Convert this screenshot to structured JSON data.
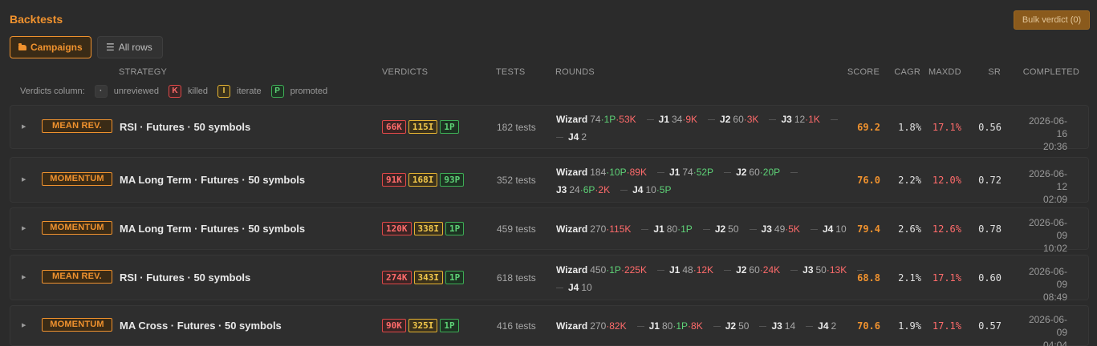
{
  "page": {
    "title": "Backtests",
    "bulk_verdict_label": "Bulk verdict (0)"
  },
  "tabs": [
    {
      "label": "Campaigns",
      "icon": "folder-icon",
      "active": true
    },
    {
      "label": "All rows",
      "icon": "list-icon",
      "active": false
    }
  ],
  "columns": {
    "strategy": "STRATEGY",
    "verdicts": "VERDICTS",
    "tests": "TESTS",
    "rounds": "ROUNDS",
    "score": "SCORE",
    "cagr": "CAGR",
    "maxdd": "MAXDD",
    "sr": "SR",
    "completed": "COMPLETED"
  },
  "legend": {
    "label": "Verdicts column:",
    "items": [
      {
        "glyph": "·",
        "text": "unreviewed",
        "kind": "dot"
      },
      {
        "glyph": "K",
        "text": "killed",
        "kind": "k"
      },
      {
        "glyph": "I",
        "text": "iterate",
        "kind": "i"
      },
      {
        "glyph": "P",
        "text": "promoted",
        "kind": "p"
      }
    ]
  },
  "colors": {
    "accent": "#f0922e",
    "killed": "#ff6b6b",
    "iterate": "#f2c84b",
    "promoted": "#5ed277",
    "background": "#2b2b2b"
  },
  "campaigns": [
    {
      "tag": "MEAN REV.",
      "strategy": "RSI · Futures · 50 symbols",
      "verdicts": {
        "k": "66K",
        "i": "115I",
        "p": "1P"
      },
      "tests": "182 tests",
      "rounds": [
        [
          {
            "name": "Wizard",
            "count": "74",
            "p": "·1P",
            "k": "·53K"
          },
          {
            "name": "J1",
            "count": "34",
            "k": "·9K"
          },
          {
            "name": "J2",
            "count": "60",
            "k": "·3K"
          },
          {
            "name": "J3",
            "count": "12",
            "k": "·1K"
          }
        ],
        [
          {
            "name": "J4",
            "count": "2"
          }
        ]
      ],
      "score": "69.2",
      "cagr": "1.8%",
      "maxdd": "17.1%",
      "sr": "0.56",
      "date": "2026-06-16",
      "time": "20:36"
    },
    {
      "tag": "MOMENTUM",
      "strategy": "MA Long Term · Futures · 50 symbols",
      "verdicts": {
        "k": "91K",
        "i": "168I",
        "p": "93P"
      },
      "tests": "352 tests",
      "rounds": [
        [
          {
            "name": "Wizard",
            "count": "184",
            "p": "·10P",
            "k": "·89K"
          },
          {
            "name": "J1",
            "count": "74",
            "p": "·52P"
          },
          {
            "name": "J2",
            "count": "60",
            "p": "·20P"
          }
        ],
        [
          {
            "name": "J3",
            "count": "24",
            "p": "·6P",
            "k": "·2K"
          },
          {
            "name": "J4",
            "count": "10",
            "p": "·5P"
          }
        ]
      ],
      "score": "76.0",
      "cagr": "2.2%",
      "maxdd": "12.0%",
      "sr": "0.72",
      "date": "2026-06-12",
      "time": "02:09"
    },
    {
      "tag": "MOMENTUM",
      "strategy": "MA Long Term · Futures · 50 symbols",
      "verdicts": {
        "k": "120K",
        "i": "338I",
        "p": "1P"
      },
      "tests": "459 tests",
      "rounds": [
        [
          {
            "name": "Wizard",
            "count": "270",
            "k": "·115K"
          },
          {
            "name": "J1",
            "count": "80",
            "p": "·1P"
          },
          {
            "name": "J2",
            "count": "50"
          },
          {
            "name": "J3",
            "count": "49",
            "k": "·5K"
          },
          {
            "name": "J4",
            "count": "10"
          }
        ]
      ],
      "score": "79.4",
      "cagr": "2.6%",
      "maxdd": "12.6%",
      "sr": "0.78",
      "date": "2026-06-09",
      "time": "10:02"
    },
    {
      "tag": "MEAN REV.",
      "strategy": "RSI · Futures · 50 symbols",
      "verdicts": {
        "k": "274K",
        "i": "343I",
        "p": "1P"
      },
      "tests": "618 tests",
      "rounds": [
        [
          {
            "name": "Wizard",
            "count": "450",
            "p": "·1P",
            "k": "·225K"
          },
          {
            "name": "J1",
            "count": "48",
            "k": "·12K"
          },
          {
            "name": "J2",
            "count": "60",
            "k": "·24K"
          },
          {
            "name": "J3",
            "count": "50",
            "k": "·13K"
          }
        ],
        [
          {
            "name": "J4",
            "count": "10"
          }
        ]
      ],
      "score": "68.8",
      "cagr": "2.1%",
      "maxdd": "17.1%",
      "sr": "0.60",
      "date": "2026-06-09",
      "time": "08:49"
    },
    {
      "tag": "MOMENTUM",
      "strategy": "MA Cross · Futures · 50 symbols",
      "verdicts": {
        "k": "90K",
        "i": "325I",
        "p": "1P"
      },
      "tests": "416 tests",
      "rounds": [
        [
          {
            "name": "Wizard",
            "count": "270",
            "k": "·82K"
          },
          {
            "name": "J1",
            "count": "80",
            "p": "·1P",
            "k": "·8K"
          },
          {
            "name": "J2",
            "count": "50"
          },
          {
            "name": "J3",
            "count": "14"
          },
          {
            "name": "J4",
            "count": "2"
          }
        ]
      ],
      "score": "70.6",
      "cagr": "1.9%",
      "maxdd": "17.1%",
      "sr": "0.57",
      "date": "2026-06-09",
      "time": "04:04"
    }
  ]
}
